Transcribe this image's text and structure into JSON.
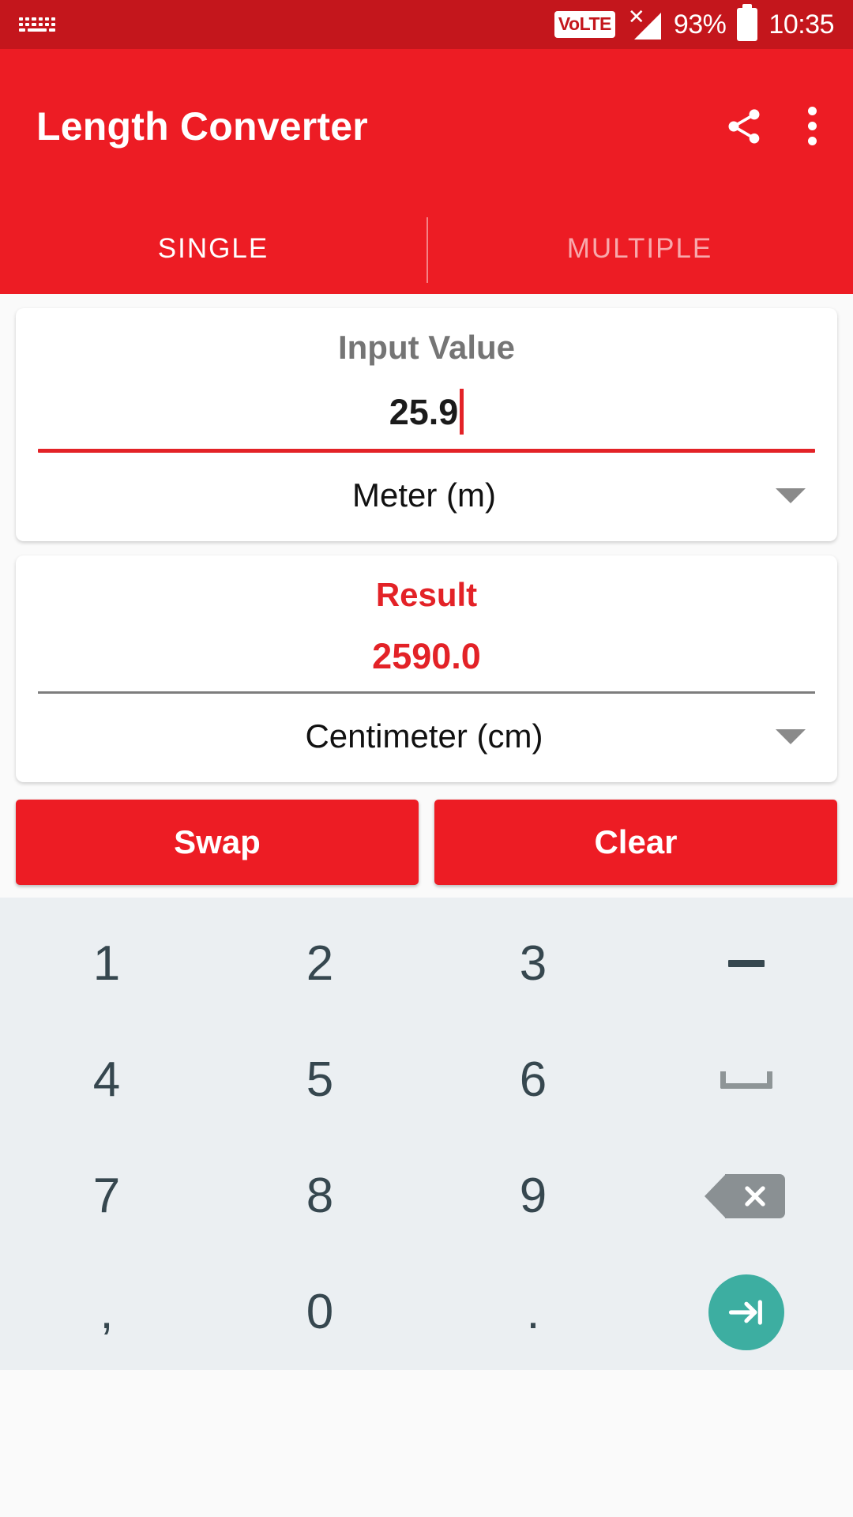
{
  "status_bar": {
    "keyboard_icon": "keyboard-icon",
    "volte_label": "VoLTE",
    "signal_icon": "signal-no-service-icon",
    "battery_percent": "93%",
    "battery_icon": "battery-icon",
    "clock": "10:35"
  },
  "app_bar": {
    "title": "Length Converter",
    "share_icon": "share-icon",
    "overflow_icon": "more-vertical-icon"
  },
  "tabs": [
    {
      "label": "SINGLE",
      "active": true
    },
    {
      "label": "MULTIPLE",
      "active": false
    }
  ],
  "input_card": {
    "label": "Input Value",
    "value": "25.9",
    "unit": "Meter (m)",
    "dropdown_icon": "chevron-down-icon",
    "underline_color": "#E32227"
  },
  "result_card": {
    "label": "Result",
    "value": "2590.0",
    "unit": "Centimeter (cm)",
    "dropdown_icon": "chevron-down-icon",
    "underline_color": "#7D7D7D"
  },
  "actions": {
    "swap_label": "Swap",
    "clear_label": "Clear"
  },
  "keyboard": {
    "rows": [
      [
        {
          "label": "1",
          "kind": "digit"
        },
        {
          "label": "2",
          "kind": "digit"
        },
        {
          "label": "3",
          "kind": "digit"
        },
        {
          "label": "–",
          "kind": "dash",
          "icon": "minus-icon"
        }
      ],
      [
        {
          "label": "4",
          "kind": "digit"
        },
        {
          "label": "5",
          "kind": "digit"
        },
        {
          "label": "6",
          "kind": "digit"
        },
        {
          "label": "",
          "kind": "space",
          "icon": "space-bar-icon"
        }
      ],
      [
        {
          "label": "7",
          "kind": "digit"
        },
        {
          "label": "8",
          "kind": "digit"
        },
        {
          "label": "9",
          "kind": "digit"
        },
        {
          "label": "",
          "kind": "backspace",
          "icon": "backspace-icon"
        }
      ],
      [
        {
          "label": ",",
          "kind": "digit"
        },
        {
          "label": "0",
          "kind": "digit"
        },
        {
          "label": ".",
          "kind": "digit"
        },
        {
          "label": "",
          "kind": "enter",
          "icon": "next-arrow-icon"
        }
      ]
    ]
  },
  "colors": {
    "status_bar": "#C4161C",
    "app_bar": "#ED1C24",
    "accent": "#ED1C24",
    "result_text": "#E32227",
    "keyboard_bg": "#EBEFF2",
    "key_text": "#36474F",
    "enter_fab": "#3DAEA1",
    "backspace": "#8A9093"
  }
}
